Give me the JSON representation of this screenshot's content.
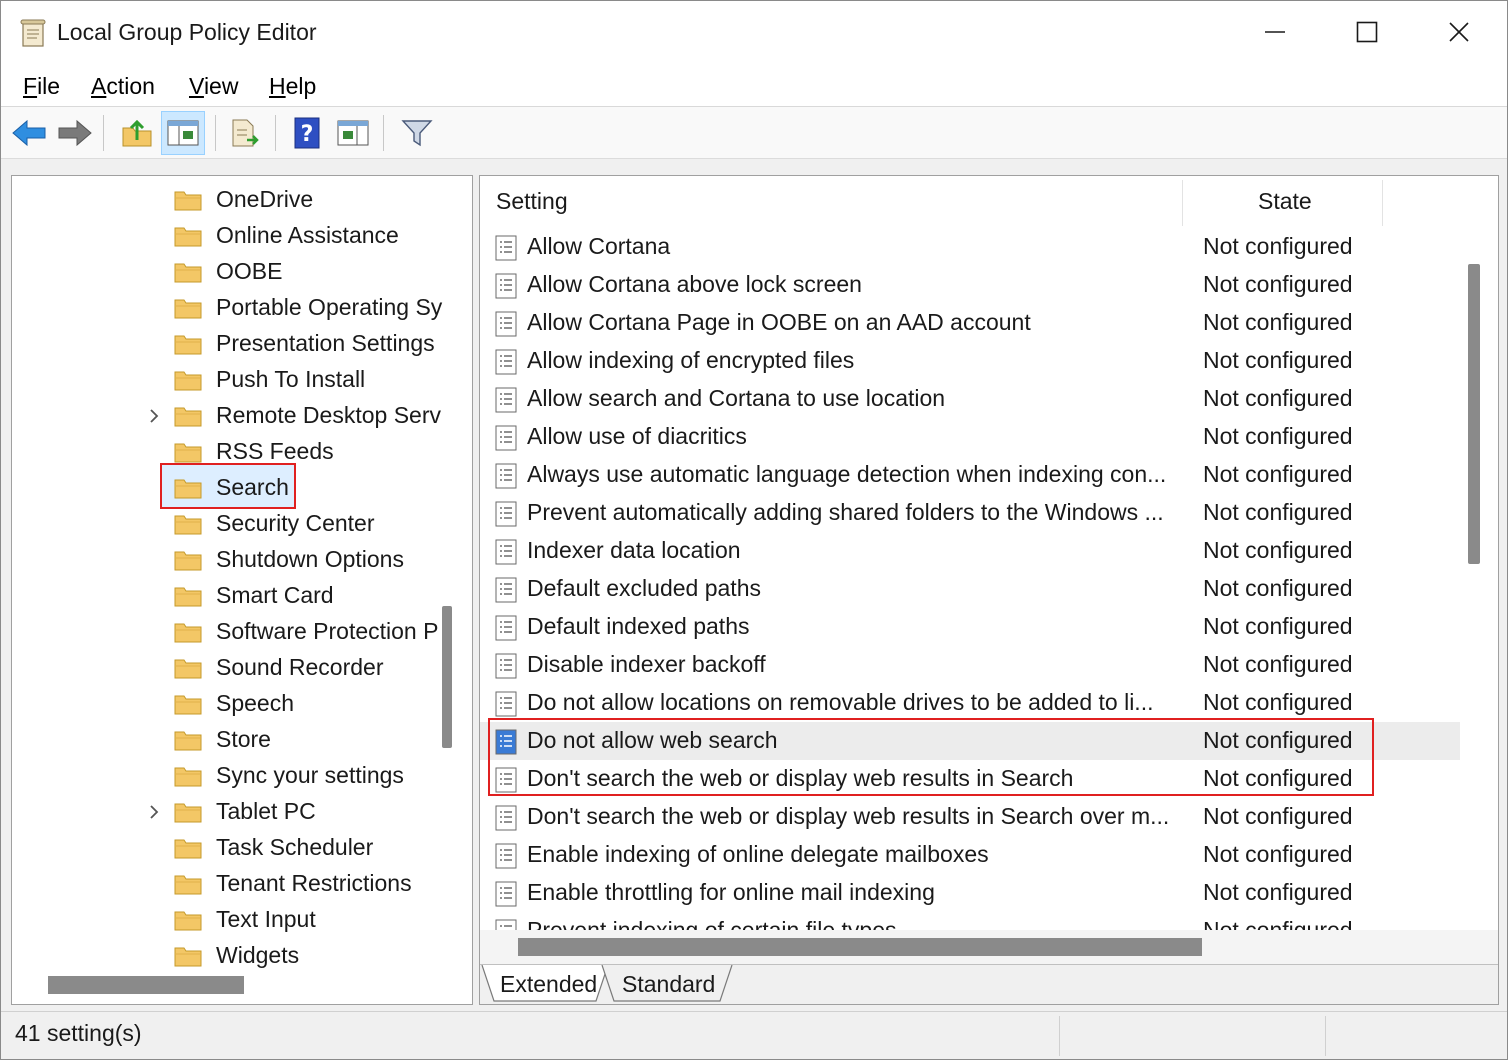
{
  "window": {
    "title": "Local Group Policy Editor",
    "minimize_icon": "minimize-icon",
    "maximize_icon": "maximize-icon",
    "close_icon": "close-icon"
  },
  "menu": [
    {
      "label": "File",
      "u": "F",
      "rest": "ile"
    },
    {
      "label": "Action",
      "u": "A",
      "rest": "ction"
    },
    {
      "label": "View",
      "u": "V",
      "rest": "iew"
    },
    {
      "label": "Help",
      "u": "H",
      "rest": "elp"
    }
  ],
  "toolbar": [
    {
      "name": "back-button",
      "icon": "back-arrow-icon"
    },
    {
      "name": "forward-button",
      "icon": "forward-arrow-icon"
    },
    {
      "name": "up-one-level-button",
      "icon": "folder-up-icon"
    },
    {
      "name": "show-hide-console-tree-button",
      "icon": "console-tree-icon",
      "pressed": true
    },
    {
      "name": "export-list-button",
      "icon": "export-list-icon"
    },
    {
      "name": "help-button",
      "icon": "help-icon"
    },
    {
      "name": "show-hide-action-pane-button",
      "icon": "action-pane-icon"
    },
    {
      "name": "filter-button",
      "icon": "filter-icon"
    }
  ],
  "tree": {
    "items": [
      {
        "label": "OneDrive",
        "expandable": false
      },
      {
        "label": "Online Assistance",
        "expandable": false
      },
      {
        "label": "OOBE",
        "expandable": false
      },
      {
        "label": "Portable Operating Sy",
        "expandable": false
      },
      {
        "label": "Presentation Settings",
        "expandable": false
      },
      {
        "label": "Push To Install",
        "expandable": false
      },
      {
        "label": "Remote Desktop Serv",
        "expandable": true
      },
      {
        "label": "RSS Feeds",
        "expandable": false
      },
      {
        "label": "Search",
        "expandable": false,
        "selected": true
      },
      {
        "label": "Security Center",
        "expandable": false
      },
      {
        "label": "Shutdown Options",
        "expandable": false
      },
      {
        "label": "Smart Card",
        "expandable": false
      },
      {
        "label": "Software Protection P",
        "expandable": false
      },
      {
        "label": "Sound Recorder",
        "expandable": false
      },
      {
        "label": "Speech",
        "expandable": false
      },
      {
        "label": "Store",
        "expandable": false
      },
      {
        "label": "Sync your settings",
        "expandable": false
      },
      {
        "label": "Tablet PC",
        "expandable": true
      },
      {
        "label": "Task Scheduler",
        "expandable": false
      },
      {
        "label": "Tenant Restrictions",
        "expandable": false
      },
      {
        "label": "Text Input",
        "expandable": false
      },
      {
        "label": "Widgets",
        "expandable": false
      }
    ]
  },
  "table": {
    "columns": {
      "setting": "Setting",
      "state": "State"
    },
    "rows": [
      {
        "name": "Allow Cortana",
        "state": "Not configured"
      },
      {
        "name": "Allow Cortana above lock screen",
        "state": "Not configured"
      },
      {
        "name": "Allow Cortana Page in OOBE on an AAD account",
        "state": "Not configured"
      },
      {
        "name": "Allow indexing of encrypted files",
        "state": "Not configured"
      },
      {
        "name": "Allow search and Cortana to use location",
        "state": "Not configured"
      },
      {
        "name": "Allow use of diacritics",
        "state": "Not configured"
      },
      {
        "name": "Always use automatic language detection when indexing con...",
        "state": "Not configured"
      },
      {
        "name": "Prevent automatically adding shared folders to the Windows ...",
        "state": "Not configured"
      },
      {
        "name": "Indexer data location",
        "state": "Not configured"
      },
      {
        "name": "Default excluded paths",
        "state": "Not configured"
      },
      {
        "name": "Default indexed paths",
        "state": "Not configured"
      },
      {
        "name": "Disable indexer backoff",
        "state": "Not configured"
      },
      {
        "name": "Do not allow locations on removable drives to be added to li...",
        "state": "Not configured"
      },
      {
        "name": "Do not allow web search",
        "state": "Not configured",
        "hover": true
      },
      {
        "name": "Don't search the web or display web results in Search",
        "state": "Not configured"
      },
      {
        "name": "Don't search the web or display web results in Search over m...",
        "state": "Not configured"
      },
      {
        "name": "Enable indexing of online delegate mailboxes",
        "state": "Not configured"
      },
      {
        "name": "Enable throttling for online mail indexing",
        "state": "Not configured"
      },
      {
        "name": "Prevent indexing of certain file types",
        "state": "Not configured"
      }
    ]
  },
  "tabs": [
    {
      "label": "Extended",
      "active": true
    },
    {
      "label": "Standard",
      "active": false
    }
  ],
  "status": {
    "text": "41 setting(s)"
  },
  "colors": {
    "highlight": "#e02020",
    "selection": "#ddeeff",
    "folder": "#f3c766"
  }
}
